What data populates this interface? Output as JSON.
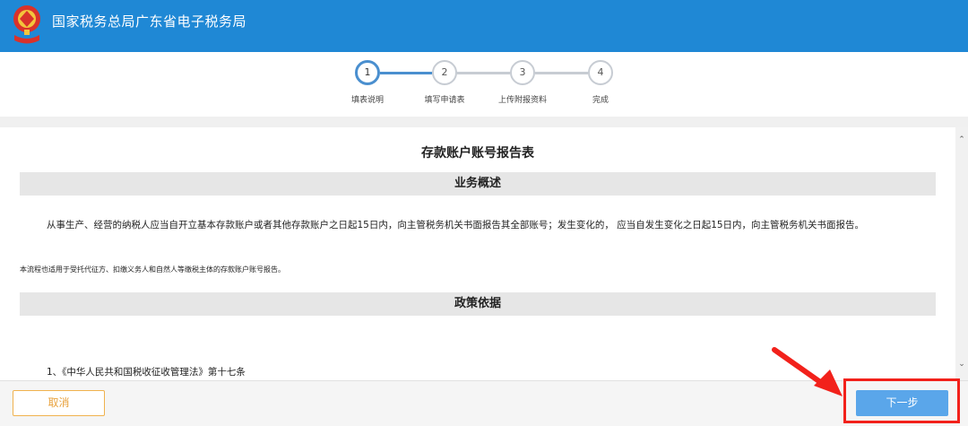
{
  "header": {
    "title": "国家税务总局广东省电子税务局",
    "brand_color": "#1f88d5",
    "emblem_icon": "tax-emblem-icon"
  },
  "steps": [
    {
      "number": "1",
      "label": "填表说明",
      "active": true
    },
    {
      "number": "2",
      "label": "填写申请表",
      "active": false
    },
    {
      "number": "3",
      "label": "上传附报资料",
      "active": false
    },
    {
      "number": "4",
      "label": "完成",
      "active": false
    }
  ],
  "document": {
    "title": "存款账户账号报告表",
    "sections": [
      {
        "heading": "业务概述",
        "paragraph": "从事生产、经营的纳税人应当自开立基本存款账户或者其他存款账户之日起15日内，向主管税务机关书面报告其全部账号；发生变化的， 应当自发生变化之日起15日内，向主管税务机关书面报告。",
        "note": "本流程也适用于受托代征方、扣缴义务人和自然人等缴税主体的存款账户账号报告。"
      },
      {
        "heading": "政策依据",
        "items": [
          "1、《中华人民共和国税收征收管理法》第十七条"
        ]
      }
    ]
  },
  "footer": {
    "cancel_label": "取消",
    "next_label": "下一步"
  },
  "colors": {
    "active_step": "#4a8fcf",
    "cancel_border": "#f0b24e",
    "next_button": "#5aa6ea",
    "highlight": "#f2211b"
  }
}
